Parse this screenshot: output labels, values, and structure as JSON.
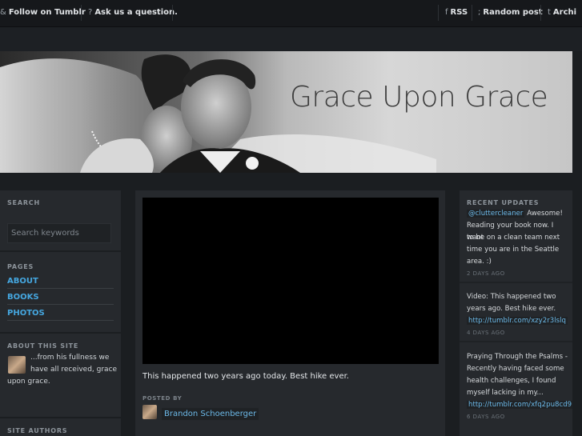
{
  "topbar": {
    "follow_label": "Follow on Tumblr",
    "ask_label": "Ask us a question.",
    "rss_label": "RSS",
    "random_label": "Random post",
    "archive_label": "Archi"
  },
  "banner": {
    "title": "Grace Upon Grace"
  },
  "sidebar": {
    "search_heading": "SEARCH",
    "search_placeholder": "Search keywords",
    "pages_heading": "PAGES",
    "pages": [
      {
        "label": "ABOUT"
      },
      {
        "label": "BOOKS"
      },
      {
        "label": "PHOTOS"
      }
    ],
    "about_heading": "ABOUT THIS SITE",
    "about_text_1": "...from his fullness we",
    "about_text_2": "have all received, grace",
    "about_text_3": "upon grace.",
    "authors_heading": "SITE AUTHORS"
  },
  "post": {
    "caption": "This happened two years ago today. Best hike ever.",
    "posted_by_label": "POSTED BY",
    "author": "Brandon Schoenberger"
  },
  "updates": {
    "heading": "RECENT UPDATES",
    "items": [
      {
        "mention": "@cluttercleaner",
        "text_1": "Awesome!",
        "text_2": "Reading your book now. I want",
        "text_3": "to be on a clean team next",
        "text_4": "time you are in the Seattle",
        "text_5": "area. :)",
        "ago": "2 DAYS AGO"
      },
      {
        "text_1": "Video: This happened two",
        "text_2": "years ago. Best hike ever.",
        "url": "http://tumblr.com/xzy2r3lslq",
        "ago": "4 DAYS AGO"
      },
      {
        "text_1": "Praying Through the Psalms -",
        "text_2": "Recently having faced some",
        "text_3": "health challenges, I found",
        "text_4": "myself lacking in my...",
        "url": "http://tumblr.com/xfq2pu8cd9",
        "ago": "6 DAYS AGO"
      }
    ]
  },
  "colors": {
    "background": "#1b1e21",
    "panel": "#26292d",
    "link": "#45a7e0"
  }
}
